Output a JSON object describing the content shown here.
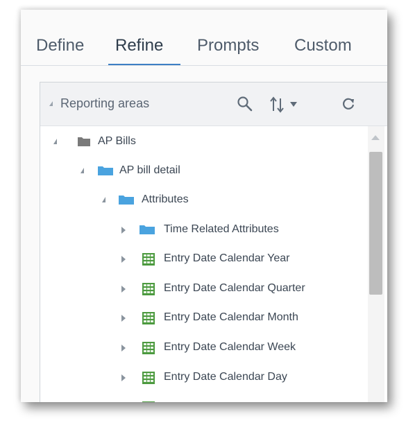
{
  "tabs": [
    {
      "label": "Define"
    },
    {
      "label": "Refine"
    },
    {
      "label": "Prompts"
    },
    {
      "label": "Custom"
    }
  ],
  "active_tab": "Refine",
  "panel": {
    "header_label": "Reporting areas",
    "header_icons": [
      "search-icon",
      "sort-icon",
      "chevron-down-icon",
      "refresh-icon"
    ]
  },
  "tree": [
    {
      "label": "AP Bills",
      "icon": "folder-gray-icon",
      "state": "expanded"
    },
    {
      "label": "AP bill detail",
      "icon": "folder-blue-icon",
      "state": "expanded"
    },
    {
      "label": "Attributes",
      "icon": "folder-blue-icon",
      "state": "expanded"
    },
    {
      "label": "Time Related Attributes",
      "icon": "folder-blue-icon",
      "state": "collapsed"
    },
    {
      "label": "Entry Date Calendar Year",
      "icon": "attribute-grid-icon",
      "state": "collapsed"
    },
    {
      "label": "Entry Date Calendar Quarter",
      "icon": "attribute-grid-icon",
      "state": "collapsed"
    },
    {
      "label": "Entry Date Calendar Month",
      "icon": "attribute-grid-icon",
      "state": "collapsed"
    },
    {
      "label": "Entry Date Calendar Week",
      "icon": "attribute-grid-icon",
      "state": "collapsed"
    },
    {
      "label": "Entry Date Calendar Day",
      "icon": "attribute-grid-icon",
      "state": "collapsed"
    }
  ],
  "colors": {
    "accent": "#3d7fc4",
    "folder_blue": "#4aa3df",
    "folder_gray": "#7a7a7a",
    "attribute_green": "#4c9a3f"
  }
}
